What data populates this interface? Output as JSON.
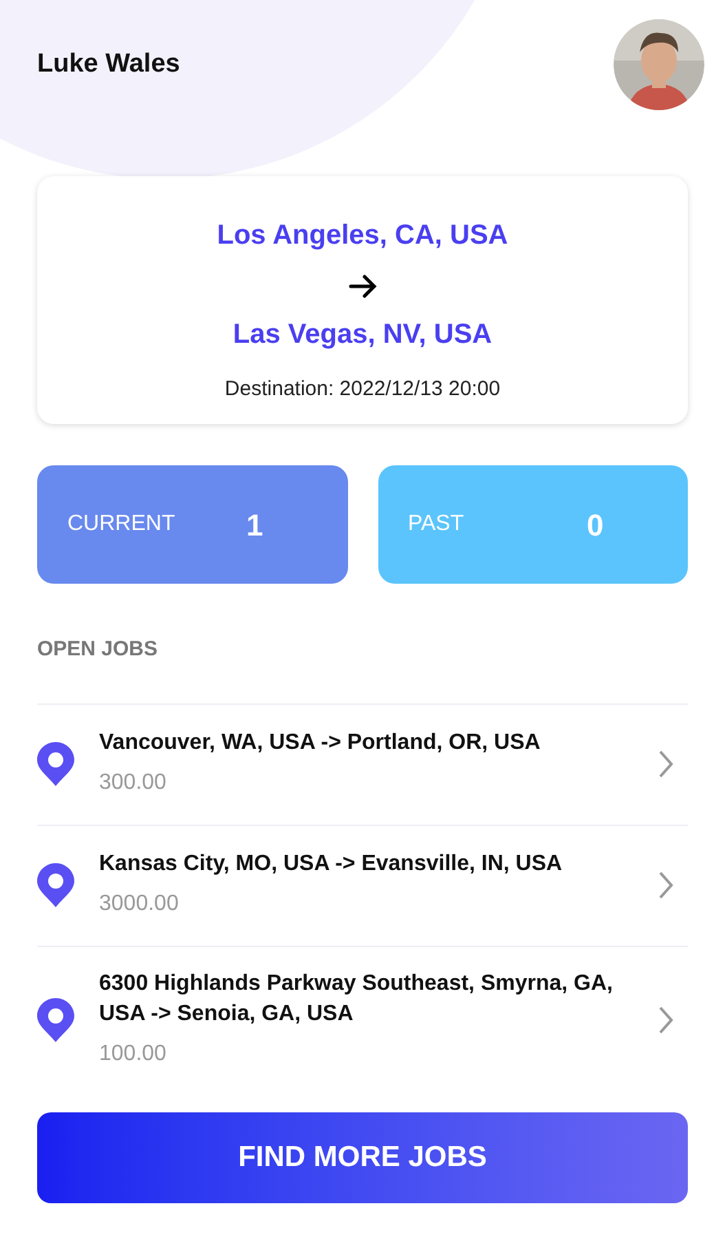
{
  "header": {
    "user_name": "Luke Wales"
  },
  "current_trip": {
    "origin": "Los Angeles, CA, USA",
    "destination": "Las Vegas, NV, USA",
    "destination_time": "Destination: 2022/12/13 20:00"
  },
  "stats": [
    {
      "label": "CURRENT",
      "count": "1",
      "color": "#6889ee"
    },
    {
      "label": "PAST",
      "count": "0",
      "color": "#5bc4fd"
    }
  ],
  "open_jobs": {
    "title": "OPEN JOBS",
    "items": [
      {
        "route": "Vancouver, WA, USA -> Portland, OR, USA",
        "price": "300.00"
      },
      {
        "route": "Kansas City, MO, USA -> Evansville, IN, USA",
        "price": "3000.00"
      },
      {
        "route": "6300 Highlands Parkway Southeast, Smyrna, GA, USA -> Senoia, GA, USA",
        "price": "100.00"
      }
    ]
  },
  "find_more_button": "FIND MORE JOBS"
}
